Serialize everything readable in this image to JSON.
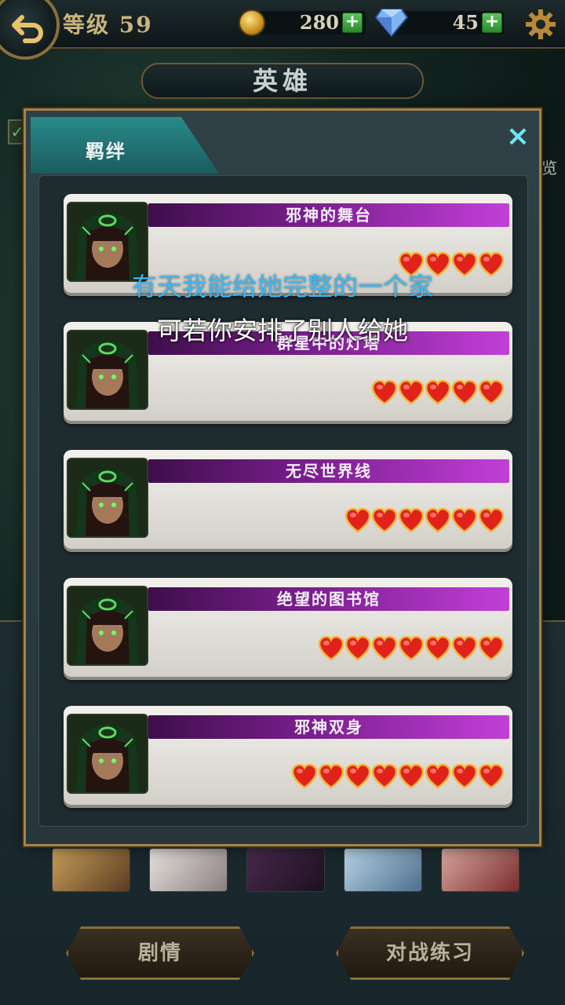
{
  "header": {
    "level_label": "等级 59",
    "gold": "280",
    "gems": "45",
    "plus": "+"
  },
  "page": {
    "title": "英雄",
    "side_text": "览"
  },
  "modal": {
    "tab_label": "羁绊",
    "close_label": "×",
    "bonds": [
      {
        "title": "邪神的舞台",
        "hearts": 4
      },
      {
        "title": "群星中的灯塔",
        "hearts": 5
      },
      {
        "title": "无尽世界线",
        "hearts": 6
      },
      {
        "title": "绝望的图书馆",
        "hearts": 7
      },
      {
        "title": "邪神双身",
        "hearts": 8
      }
    ]
  },
  "bottom": {
    "story_button": "剧情",
    "practice_button": "对战练习"
  },
  "subtitles": {
    "line1": "有天我能给她完整的一个家",
    "line2": "可若你安排了别人给她"
  },
  "colors": {
    "accent_gold": "#a3834a",
    "tab_teal": "#2a8a8a",
    "band_purple": "#7a1f8e",
    "heart_red": "#e0231a",
    "subtitle_blue": "#3cb8f4"
  },
  "icons": {
    "back": "back-arrow-icon",
    "gold": "coin-icon",
    "gem": "diamond-icon",
    "settings": "gear-icon",
    "close": "close-icon",
    "heart": "heart-icon"
  }
}
